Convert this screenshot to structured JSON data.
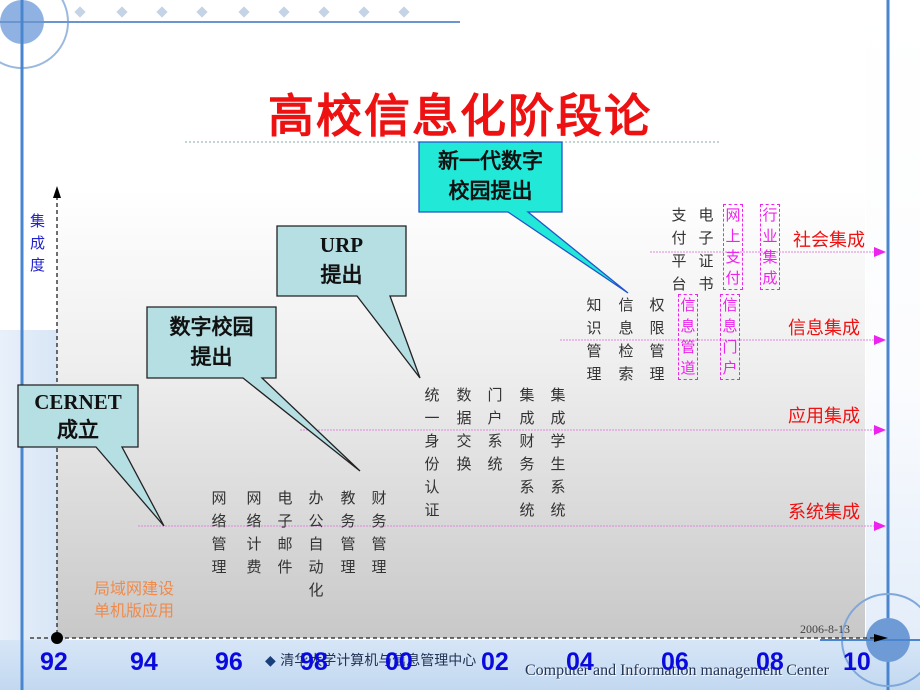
{
  "title": "高校信息化阶段论",
  "y_axis_label": "集成度",
  "callouts": [
    {
      "id": "cernet",
      "line1": "CERNET",
      "line2": "成立"
    },
    {
      "id": "digital-campus",
      "line1": "数字校园",
      "line2": "提出"
    },
    {
      "id": "urp",
      "line1": "URP",
      "line2": "提出"
    },
    {
      "id": "new-digital-campus",
      "line1": "新一代数字",
      "line2": "校园提出"
    }
  ],
  "stages": [
    {
      "id": "system",
      "label": "系统集成"
    },
    {
      "id": "application",
      "label": "应用集成"
    },
    {
      "id": "information",
      "label": "信息集成"
    },
    {
      "id": "social",
      "label": "社会集成"
    }
  ],
  "base_stage_label": [
    "局域网建设",
    "单机版应用"
  ],
  "system_items": [
    "网络管理",
    "网络计费",
    "电子邮件",
    "办公自动化",
    "教务管理",
    "财务管理"
  ],
  "application_items": [
    "统一身份认证",
    "数据交换",
    "门户系统",
    "集成财务系统",
    "集成学生系统"
  ],
  "information_items": [
    "知识管理",
    "信息检索",
    "权限管理"
  ],
  "information_future_items": [
    "信息管道",
    "信息门户"
  ],
  "social_items": [
    "支付平台",
    "电子证书"
  ],
  "social_future_items": [
    "网上支付",
    "行业集成"
  ],
  "x_axis_years": [
    "92",
    "94",
    "96",
    "98",
    "00",
    "02",
    "04",
    "06",
    "08",
    "10"
  ],
  "date": "2006-8-13",
  "footer_cn": "清华大学计算机与信息管理中心",
  "footer_en": "Computer and Information management Center",
  "colors": {
    "title": "#ee1111",
    "year": "#0a0adf",
    "stage": "#ee1111",
    "future": "#ee22ee",
    "callout": "#b6dfe3",
    "callout_new": "#22e8d8",
    "base_stage": "#f08a4b",
    "axis_label": "#2222cc"
  }
}
